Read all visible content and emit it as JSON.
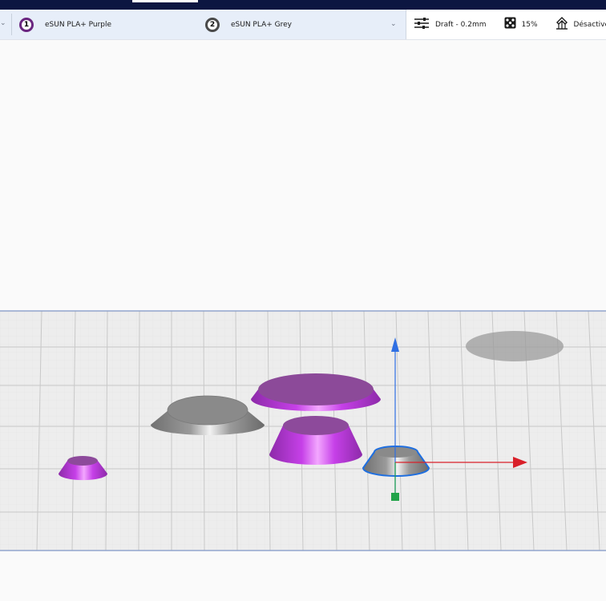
{
  "toolbar": {
    "extruders": [
      {
        "number": "1",
        "material": "eSUN PLA+ Purple",
        "color": "#6a2680"
      },
      {
        "number": "2",
        "material": "eSUN PLA+ Grey",
        "color": "#4a4a4a"
      }
    ],
    "profile": "Draft - 0.2mm",
    "infill": "15%",
    "support": "Désactivé"
  },
  "icons": {
    "profile": "sliders-icon",
    "infill": "infill-icon",
    "support": "support-icon",
    "dropdown": "chevron-down-icon"
  },
  "colors": {
    "header": "#0c1641",
    "material_bar": "#e7eef9",
    "purple_material": "#c640e8",
    "grey_material": "#8c8c8c",
    "selection": "#1f6fe0",
    "axis_x": "#d9202a",
    "axis_y": "#2f6fe3",
    "axis_z": "#22a34a"
  }
}
